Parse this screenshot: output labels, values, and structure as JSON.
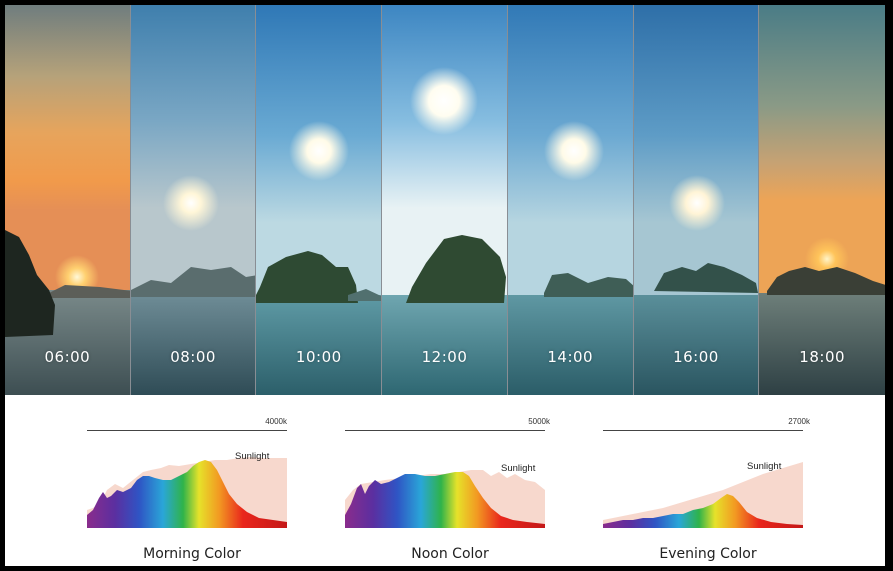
{
  "time_panels": [
    {
      "time": "06:00"
    },
    {
      "time": "08:00"
    },
    {
      "time": "10:00"
    },
    {
      "time": "12:00"
    },
    {
      "time": "14:00"
    },
    {
      "time": "16:00"
    },
    {
      "time": "18:00"
    }
  ],
  "spectra": [
    {
      "kelvin": "4000k",
      "sunlight_label": "Sunlight",
      "caption": "Morning Color"
    },
    {
      "kelvin": "5000k",
      "sunlight_label": "Sunlight",
      "caption": "Noon Color"
    },
    {
      "kelvin": "2700k",
      "sunlight_label": "Sunlight",
      "caption": "Evening Color"
    }
  ]
}
